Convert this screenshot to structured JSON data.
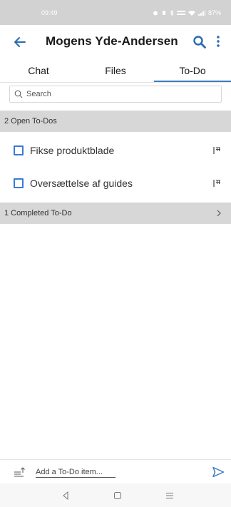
{
  "status_bar": {
    "time": "09:49",
    "battery": "87%"
  },
  "header": {
    "title": "Mogens Yde-Andersen"
  },
  "tabs": [
    {
      "label": "Chat",
      "active": false
    },
    {
      "label": "Files",
      "active": false
    },
    {
      "label": "To-Do",
      "active": true
    }
  ],
  "search": {
    "placeholder": "Search"
  },
  "open_section": {
    "label": "2 Open To-Dos"
  },
  "todos": [
    {
      "label": "Fikse produktblade"
    },
    {
      "label": "Oversættelse af guides"
    }
  ],
  "completed_section": {
    "label": "1 Completed To-Do"
  },
  "add_bar": {
    "placeholder": "Add a To-Do item..."
  },
  "colors": {
    "accent": "#3b7bbf",
    "checkbox": "#3a7bd5",
    "section_bg": "#d7d7d7",
    "status_bar_bg": "#d2d2d2"
  }
}
